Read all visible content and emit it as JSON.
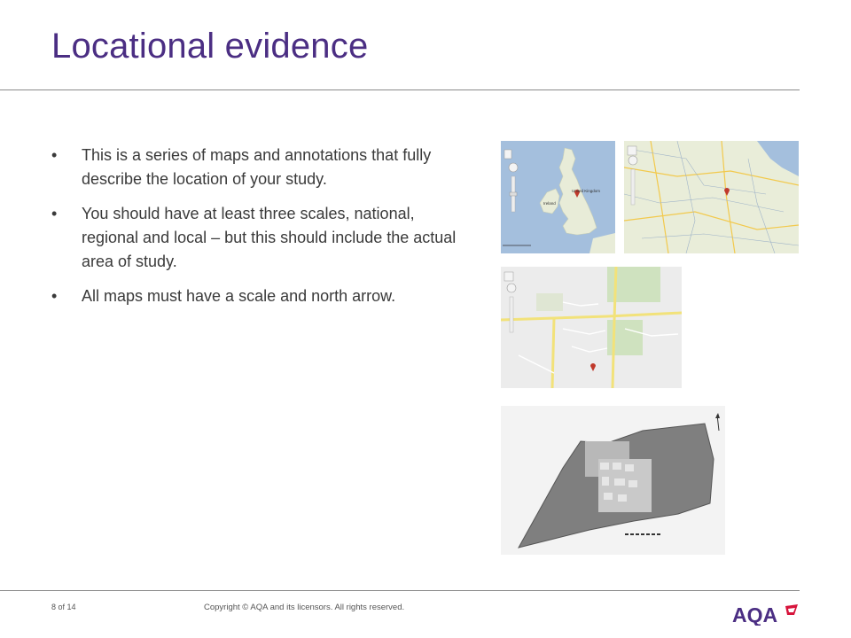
{
  "slide": {
    "title": "Locational evidence"
  },
  "bullets": [
    {
      "symbol": "•",
      "text": "This is a series of maps and annotations that fully describe the location of your study."
    },
    {
      "symbol": "•",
      "text": "You should have at least three scales, national, regional and local – but this should include the actual area of study."
    },
    {
      "symbol": "•",
      "text": "All maps must have a scale and north arrow."
    }
  ],
  "maps": {
    "uk_label": "United Kingdom",
    "ireland_label": "Ireland"
  },
  "footer": {
    "page": "8 of 14",
    "copyright": "Copyright © AQA and its licensors. All rights reserved.",
    "logo_text": "AQA"
  },
  "colors": {
    "title": "#4b2e83",
    "logo": "#4b2e83",
    "logo_accent": "#d7143c",
    "sea": "#a4bfdd",
    "land": "#e8ecd8"
  }
}
